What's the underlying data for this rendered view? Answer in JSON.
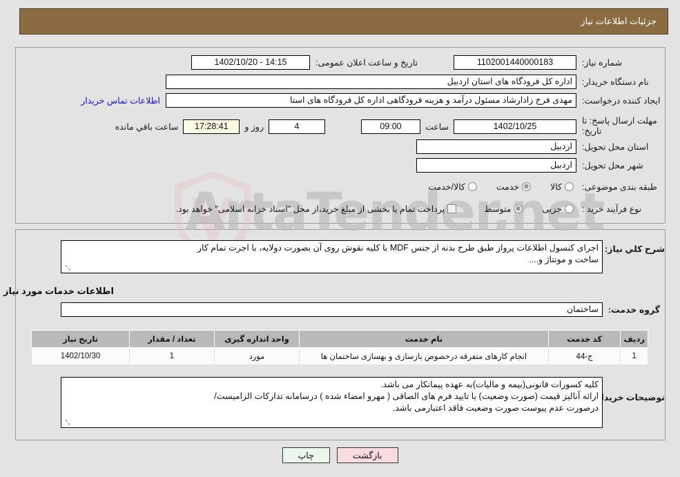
{
  "header": {
    "title": "جزئیات اطلاعات نیاز"
  },
  "watermark": {
    "text": "ArtaTender.net"
  },
  "form": {
    "need_number_label": "شماره نیاز:",
    "need_number_value": "1102001440000183",
    "announce_label": "تاریخ و ساعت اعلان عمومی:",
    "announce_value": "14:15 - 1402/10/20",
    "buyer_org_label": "نام دستگاه خریدار:",
    "buyer_org_value": "اداره کل فرودگاه های استان اردبیل",
    "creator_label": "ایجاد کننده درخواست:",
    "creator_value": "مهدی فرخ زادارشاد مسئول درآمد و هزینه فرودگاهی اداره کل فرودگاه های استا",
    "contact_link": "اطلاعات تماس خریدار",
    "deadline_label": "مهلت ارسال پاسخ: تا تاریخ:",
    "deadline_date": "1402/10/25",
    "time_label": "ساعت",
    "deadline_time": "09:00",
    "days_value": "4",
    "days_label": "روز و",
    "countdown_value": "17:28:41",
    "countdown_label": "ساعت باقي مانده",
    "province_label": "استان محل تحویل:",
    "province_value": "اردبیل",
    "city_label": "شهر محل تحویل:",
    "city_value": "اردبیل",
    "category_label": "طبقه بندی موضوعی:",
    "category_options": [
      {
        "label": "کالا",
        "selected": false
      },
      {
        "label": "خدمت",
        "selected": true
      },
      {
        "label": "کالا/خدمت",
        "selected": false
      }
    ],
    "process_label": "نوع فرآیند خرید :",
    "process_options": [
      {
        "label": "جزیی",
        "selected": false
      },
      {
        "label": "متوسط",
        "selected": true
      }
    ],
    "treasury_checkbox_label": "پرداخت تمام یا بخشی از مبلغ خرید،از محل \"اسناد خزانه اسلامی\" خواهد بود.",
    "treasury_checked": false
  },
  "description": {
    "label": "شرح کلي نیاز:",
    "line1": "اجرای کنسول اطلاعات پرواز طبق طرح بدنه از جنس MDF با کلیه نقوش روی آن بصورت دولایه، با اجرت تمام کار",
    "line2": "ساخت و مونتاژ و...."
  },
  "services": {
    "section_title": "اطلاعات خدمات مورد نیاز",
    "group_label": "گروه خدمت:",
    "group_value": "ساختمان",
    "columns": [
      "ردیف",
      "کد خدمت",
      "نام خدمت",
      "واحد اندازه گیری",
      "تعداد / مقدار",
      "تاریخ نیاز"
    ],
    "rows": [
      {
        "index": "1",
        "code": "ج-44",
        "name": "انجام کارهای متفرقه درخصوص بازسازی و بهسازی ساختمان ها",
        "unit": "مورد",
        "qty": "1",
        "date": "1402/10/30"
      }
    ]
  },
  "notes": {
    "label": "توضیحات خریدار:",
    "line1": "کلیه کسورات قانونی(بیمه و مالیات)به عهده پیمانکار می باشد.",
    "line2": "ارائه آنالیز قیمت (صورت وضعیت) با تایید فرم های الصاقی ( مهرو امضاء شده ) درسامانه تدارکات الزامیست/",
    "line3": "درصورت عدم پیوست صورت وضعیت فاقد اعتبارمی باشد."
  },
  "buttons": {
    "print": "چاپ",
    "back": "بازگشت"
  },
  "colors": {
    "header_bg": "#8b6c42",
    "page_bg": "#e3e3e3",
    "link": "#1414c8",
    "table_header_bg": "#b9b9b9",
    "print_btn_bg": "#eaf7ea",
    "back_btn_bg": "#fadcdc"
  }
}
